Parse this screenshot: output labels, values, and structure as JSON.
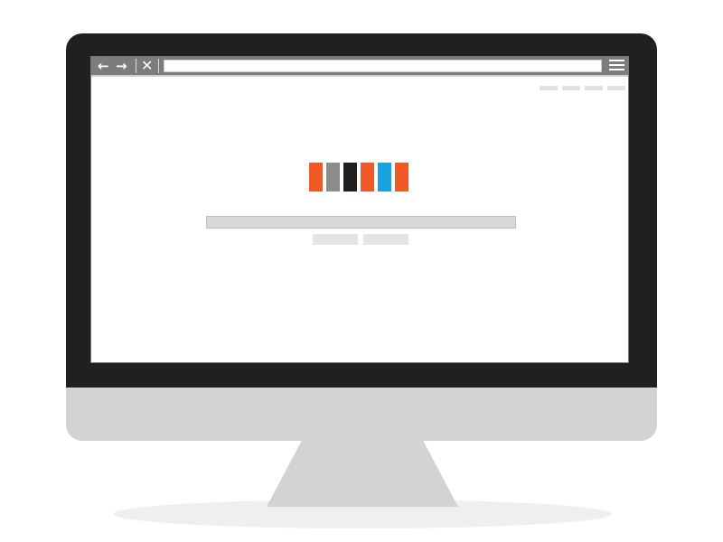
{
  "colors": {
    "bezel": "#202020",
    "monitor_silver": "#d3d3d3",
    "toolbar": "#7c7c7c",
    "logo_blocks": [
      "#f05a28",
      "#8c8c8c",
      "#1f1f1f",
      "#f05a28",
      "#1aa3df",
      "#f05a28"
    ]
  },
  "browser": {
    "toolbar_icons": [
      "back-arrow-icon",
      "forward-arrow-icon",
      "close-icon",
      "hamburger-menu-icon"
    ],
    "address_bar": "",
    "top_links": [
      "",
      "",
      "",
      ""
    ]
  },
  "search": {
    "query": "",
    "buttons": [
      "",
      ""
    ]
  }
}
